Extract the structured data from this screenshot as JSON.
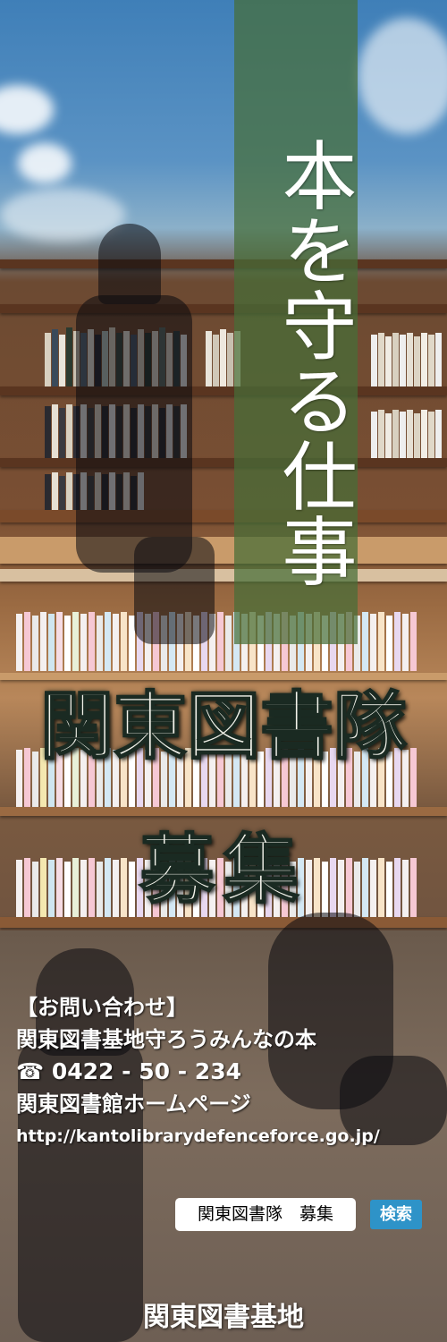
{
  "title_vertical": "本を守る仕事",
  "unit_name": "関東図書隊",
  "recruit": "募集",
  "contact": {
    "heading": "【お問い合わせ】",
    "address": "関東図書基地守ろうみんなの本",
    "phone_icon": "phone-icon",
    "phone": "0422 - 50 - 234",
    "homepage_label": "関東図書館ホームページ",
    "url": "http://kantolibrarydefenceforce.go.jp/"
  },
  "search": {
    "query": "関東図書隊　募集",
    "button_label": "検索",
    "button_color": "#2e93c8"
  },
  "footer": "関東図書基地",
  "colors": {
    "banner": "#466e37",
    "title_text": "#ffffff"
  }
}
